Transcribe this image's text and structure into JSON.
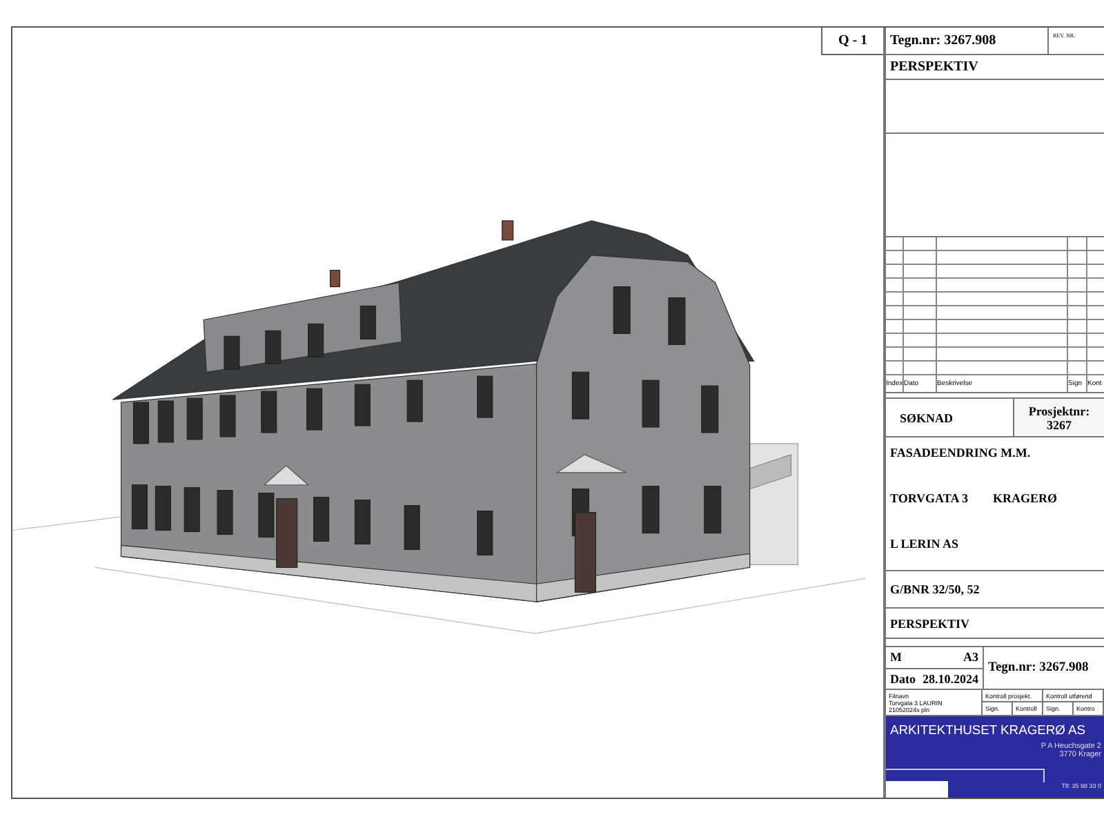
{
  "sheet": {
    "number": "Q - 1"
  },
  "title_block": {
    "drawing_number": "Tegn.nr: 3267.908",
    "rev_label": "REV. NR.",
    "view": "PERSPEKTIV",
    "revision_table": {
      "columns": [
        "Index",
        "Dato",
        "Beskrivelse",
        "Sign",
        "Kont"
      ]
    },
    "status": "SØKNAD",
    "project_label": "Prosjektnr:",
    "project_number": "3267",
    "description": "FASADEENDRING M.M.",
    "address": "TORVGATA 3",
    "place": "KRAGERØ",
    "client": "L LERIN AS",
    "property": "G/BNR 32/50, 52",
    "view_2": "PERSPEKTIV",
    "scale_label": "M",
    "paper": "A3",
    "date_label": "Dato",
    "date": "28.10.2024",
    "drawing_number_2": "Tegn.nr: 3267.908",
    "file_label": "Filnavn",
    "file_lines": [
      "Torvgata 3 LAURIN",
      "21052024s pln"
    ],
    "control_headers": [
      "Kontroll prosjekt.",
      "Kontroll utførend"
    ],
    "control_cells": [
      "Sign.",
      "Kontroll",
      "Sign.",
      "Kontro"
    ],
    "firm": {
      "name": "ARKITEKTHUSET KRAGERØ AS",
      "address_lines": [
        "P A Heuchsgate 2",
        "3770 Krager"
      ],
      "phone": "Tlf: 35 98 33 0"
    }
  }
}
